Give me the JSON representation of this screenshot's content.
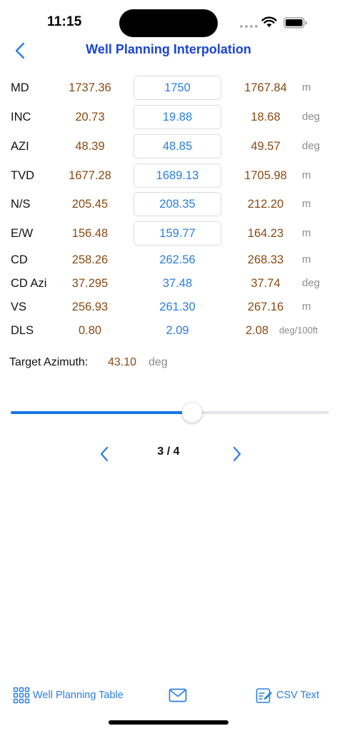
{
  "status": {
    "time": "11:15"
  },
  "nav": {
    "title": "Well Planning Interpolation"
  },
  "rows": [
    {
      "label": "MD",
      "prev": "1737.36",
      "cur": "1750",
      "next": "1767.84",
      "unit": "m"
    },
    {
      "label": "INC",
      "prev": "20.73",
      "cur": "19.88",
      "next": "18.68",
      "unit": "deg"
    },
    {
      "label": "AZI",
      "prev": "48.39",
      "cur": "48.85",
      "next": "49.57",
      "unit": "deg"
    },
    {
      "label": "TVD",
      "prev": "1677.28",
      "cur": "1689.13",
      "next": "1705.98",
      "unit": "m"
    },
    {
      "label": "N/S",
      "prev": "205.45",
      "cur": "208.35",
      "next": "212.20",
      "unit": "m"
    },
    {
      "label": "E/W",
      "prev": "156.48",
      "cur": "159.77",
      "next": "164.23",
      "unit": "m"
    },
    {
      "label": "CD",
      "prev": "258.26",
      "cur": "262.56",
      "next": "268.33",
      "unit": "m"
    },
    {
      "label": "CD Azi",
      "prev": "37.295",
      "cur": "37.48",
      "next": "37.74",
      "unit": "deg"
    },
    {
      "label": "VS",
      "prev": "256.93",
      "cur": "261.30",
      "next": "267.16",
      "unit": "m"
    },
    {
      "label": "DLS",
      "prev": "0.80",
      "cur": "2.09",
      "next": "2.08",
      "unit": "deg/100ft"
    }
  ],
  "target": {
    "label": "Target Azimuth:",
    "value": "43.10",
    "unit": "deg"
  },
  "slider": {
    "value": 0.57
  },
  "pager": {
    "text": "3 / 4"
  },
  "toolbar": {
    "table_label": "Well Planning Table",
    "csv_label": "CSV Text"
  },
  "colors": {
    "accent": "#2a7fe0",
    "title": "#1a45d6",
    "value": "#8a4a12",
    "unit": "#8c8c8c"
  },
  "icons": {
    "back": "chevron-left-icon",
    "table": "grid-icon",
    "mail": "envelope-icon",
    "csv": "square-pencil-icon"
  }
}
